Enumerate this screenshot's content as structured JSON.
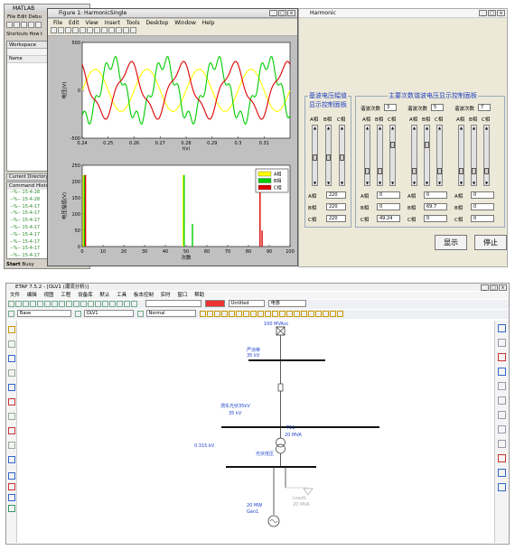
{
  "matlab": {
    "title": "MATLAB",
    "menu": [
      "File",
      "Edit",
      "Debu"
    ],
    "shortcuts": "Shortcuts",
    "how_to": "How t",
    "workspace": "Workspace",
    "ws_header": "Name",
    "current_dir_tab": "Current Directory",
    "command_history": "Command Histo",
    "history_lines": [
      "--%-- 15-4-28",
      "--%-- 15-4-28",
      "--%-- 15-4-17",
      "--%-- 15-4-17",
      "--%-- 15-4-17",
      "--%-- 15-4-17",
      "--%-- 15-4-17",
      "--%-- 15-4-17",
      "--%-- 15-4-17",
      "--%-- 15-4-17"
    ],
    "start": "Start",
    "busy": "Busy"
  },
  "figure": {
    "title": "Figure 1: HarmonicSingle",
    "menu": [
      "File",
      "Edit",
      "View",
      "Insert",
      "Tools",
      "Desktop",
      "Window",
      "Help"
    ]
  },
  "chart_data": [
    {
      "type": "line",
      "ylabel": "电压(V)",
      "xlabel": "t(s)",
      "xlim": [
        0.24,
        0.32
      ],
      "ylim": [
        -500,
        500
      ],
      "xticks": [
        "0.24",
        "0.25",
        "0.26",
        "0.27",
        "0.28",
        "0.29",
        "0.3",
        "0.31"
      ],
      "yticks": [
        "500",
        "0",
        "-500"
      ],
      "series": [
        {
          "color": "#ffff00",
          "amplitude": 220,
          "phase_deg": 0
        },
        {
          "color": "#00cc00",
          "amplitude": 300,
          "phase_deg": -120
        },
        {
          "color": "#dd0000",
          "amplitude": 260,
          "phase_deg": 120
        }
      ]
    },
    {
      "type": "bar",
      "ylabel": "电压幅值(V)",
      "xlabel": "次数",
      "xlim": [
        0,
        100
      ],
      "ylim": [
        0,
        250
      ],
      "xticks": [
        "0",
        "10",
        "20",
        "30",
        "40",
        "50",
        "60",
        "70",
        "80",
        "90",
        "100"
      ],
      "yticks": [
        "0",
        "50",
        "100",
        "150",
        "200",
        "250"
      ],
      "legend": [
        "A相",
        "B相",
        "C相"
      ],
      "legend_position": "top-right",
      "bars": [
        {
          "x": 1,
          "phase": "A相",
          "value": 220,
          "color": "#ffff00"
        },
        {
          "x": 1,
          "phase": "B相",
          "value": 220,
          "color": "#00cc00"
        },
        {
          "x": 1,
          "phase": "C相",
          "value": 220,
          "color": "#dd0000"
        },
        {
          "x": 49,
          "phase": "A相",
          "value": 220,
          "color": "#ffff00"
        },
        {
          "x": 49,
          "phase": "B相",
          "value": 220,
          "color": "#00cc00"
        },
        {
          "x": 53,
          "phase": "B相",
          "value": 69.7,
          "color": "#00cc00"
        },
        {
          "x": 85,
          "phase": "C相",
          "value": 220,
          "color": "#dd0000"
        },
        {
          "x": 86,
          "phase": "C相",
          "value": 49.24,
          "color": "#dd0000"
        }
      ]
    }
  ],
  "harmonic": {
    "title": "Harmonic",
    "base_panel_title": [
      "基波电压幅值",
      "显示控制面板"
    ],
    "main_panel_title": "主要次数谐波电压显示控制面板",
    "phase_labels": [
      "A相",
      "B相",
      "C相"
    ],
    "base_values": [
      "220",
      "220",
      "220"
    ],
    "harmonic_count_label": "谐波次数",
    "groups": [
      {
        "order": "3",
        "values": [
          "0",
          "0",
          "49.24"
        ]
      },
      {
        "order": "5",
        "values": [
          "0",
          "69.7",
          "0"
        ]
      },
      {
        "order": "7",
        "values": [
          "0",
          "0",
          "0"
        ]
      }
    ],
    "show_button": "显示",
    "stop_button": "停止"
  },
  "etap": {
    "title": "ETAP 7.5.2 - [OLV1 (潮流分析)]",
    "menu": [
      "文件",
      "编辑",
      "视图",
      "工程",
      "设备库",
      "默认",
      "工具",
      "板本控制",
      "实时",
      "窗口",
      "帮助"
    ],
    "combo_base": "Base",
    "combo_olv": "OLV1",
    "combo_normal": "Normal",
    "combo_untitled": "Untitled",
    "combo_liudian": "电感",
    "grid_label": [
      "100 MVAsc"
    ],
    "bus_top": [
      "严凉荣",
      "35 kV"
    ],
    "bus_mid": [
      "渭东光伏35kV",
      "35 kV"
    ],
    "transformer": [
      "T11",
      "20 MVA"
    ],
    "bus_low": [
      "0.315 kV",
      "光伏低压"
    ],
    "load": [
      "Load1",
      "20 MVA"
    ],
    "gen": [
      "20 MW",
      "Gen1"
    ]
  }
}
